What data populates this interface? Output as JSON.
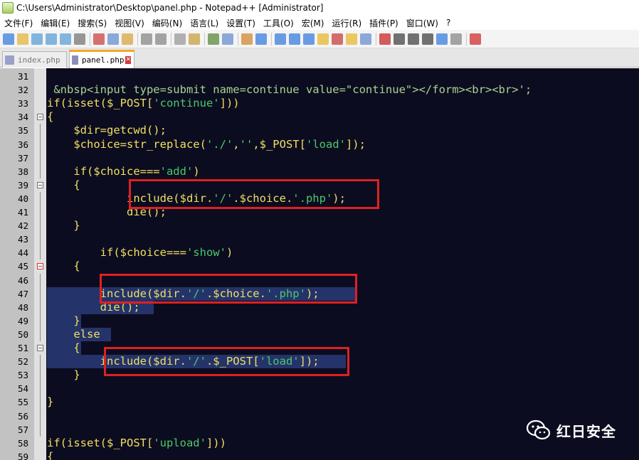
{
  "window": {
    "title": "C:\\Users\\Administrator\\Desktop\\panel.php - Notepad++ [Administrator]"
  },
  "menu": [
    "文件(F)",
    "编辑(E)",
    "搜索(S)",
    "视图(V)",
    "编码(N)",
    "语言(L)",
    "设置(T)",
    "工具(O)",
    "宏(M)",
    "运行(R)",
    "插件(P)",
    "窗口(W)",
    "?"
  ],
  "tabs": [
    {
      "label": "index.php",
      "active": false,
      "close": "✕"
    },
    {
      "label": "panel.php",
      "active": true,
      "close": "✕"
    }
  ],
  "editor": {
    "lines": [
      {
        "n": "31",
        "code": []
      },
      {
        "n": "32",
        "code": [
          {
            "t": " &nbsp<input type=submit name=continue value=\"continue\"></form><br><br>';",
            "c": "m"
          }
        ]
      },
      {
        "n": "33",
        "code": [
          {
            "t": "if(isset($_POST["
          },
          {
            "t": "'continue'",
            "c": "s"
          },
          {
            "t": "]))"
          }
        ]
      },
      {
        "n": "34",
        "code": [
          {
            "t": "{"
          }
        ]
      },
      {
        "n": "35",
        "code": [
          {
            "t": "    $dir=getcwd();"
          }
        ]
      },
      {
        "n": "36",
        "code": [
          {
            "t": "    $choice=str_replace("
          },
          {
            "t": "'./'",
            "c": "s"
          },
          {
            "t": ","
          },
          {
            "t": "''",
            "c": "s"
          },
          {
            "t": ",$_POST["
          },
          {
            "t": "'load'",
            "c": "s"
          },
          {
            "t": "]);"
          }
        ]
      },
      {
        "n": "37",
        "code": []
      },
      {
        "n": "38",
        "code": [
          {
            "t": "    if($choice==="
          },
          {
            "t": "'add'",
            "c": "s"
          },
          {
            "t": ")"
          }
        ]
      },
      {
        "n": "39",
        "code": [
          {
            "t": "    {"
          }
        ]
      },
      {
        "n": "40",
        "code": [
          {
            "t": "            include($dir."
          },
          {
            "t": "'/'",
            "c": "s"
          },
          {
            "t": ".$choice."
          },
          {
            "t": "'.php'",
            "c": "s"
          },
          {
            "t": ");"
          }
        ]
      },
      {
        "n": "41",
        "code": [
          {
            "t": "            die();"
          }
        ]
      },
      {
        "n": "42",
        "code": [
          {
            "t": "    }"
          }
        ]
      },
      {
        "n": "43",
        "code": []
      },
      {
        "n": "44",
        "code": [
          {
            "t": "        if($choice==="
          },
          {
            "t": "'show'",
            "c": "s"
          },
          {
            "t": ")"
          }
        ]
      },
      {
        "n": "45",
        "code": [
          {
            "t": "    {"
          }
        ]
      },
      {
        "n": "46",
        "code": []
      },
      {
        "n": "47",
        "code": [
          {
            "t": "        include($dir."
          },
          {
            "t": "'/'",
            "c": "s"
          },
          {
            "t": ".$choice."
          },
          {
            "t": "'.php'",
            "c": "s"
          },
          {
            "t": ");"
          }
        ]
      },
      {
        "n": "48",
        "code": [
          {
            "t": "        die();"
          }
        ]
      },
      {
        "n": "49",
        "code": [
          {
            "t": "    }"
          }
        ]
      },
      {
        "n": "50",
        "code": [
          {
            "t": "    else"
          }
        ]
      },
      {
        "n": "51",
        "code": [
          {
            "t": "    {"
          }
        ]
      },
      {
        "n": "52",
        "code": [
          {
            "t": "        include($dir."
          },
          {
            "t": "'/'",
            "c": "s"
          },
          {
            "t": ".$_POST["
          },
          {
            "t": "'load'",
            "c": "s"
          },
          {
            "t": "]);"
          }
        ]
      },
      {
        "n": "53",
        "code": [
          {
            "t": "    }"
          }
        ]
      },
      {
        "n": "54",
        "code": []
      },
      {
        "n": "55",
        "code": [
          {
            "t": "}"
          }
        ]
      },
      {
        "n": "56",
        "code": []
      },
      {
        "n": "57",
        "code": []
      },
      {
        "n": "58",
        "code": [
          {
            "t": "if(isset($_POST["
          },
          {
            "t": "'upload'",
            "c": "s"
          },
          {
            "t": "]))"
          }
        ]
      },
      {
        "n": "59",
        "code": [
          {
            "t": "{"
          }
        ]
      }
    ]
  },
  "watermark": {
    "text": "红日安全"
  },
  "colors": {
    "editor_bg": "#0c0c20",
    "keyword": "#f0e060",
    "string": "#49c96a",
    "selection": "#25336b",
    "highlight_box": "#e02020"
  }
}
